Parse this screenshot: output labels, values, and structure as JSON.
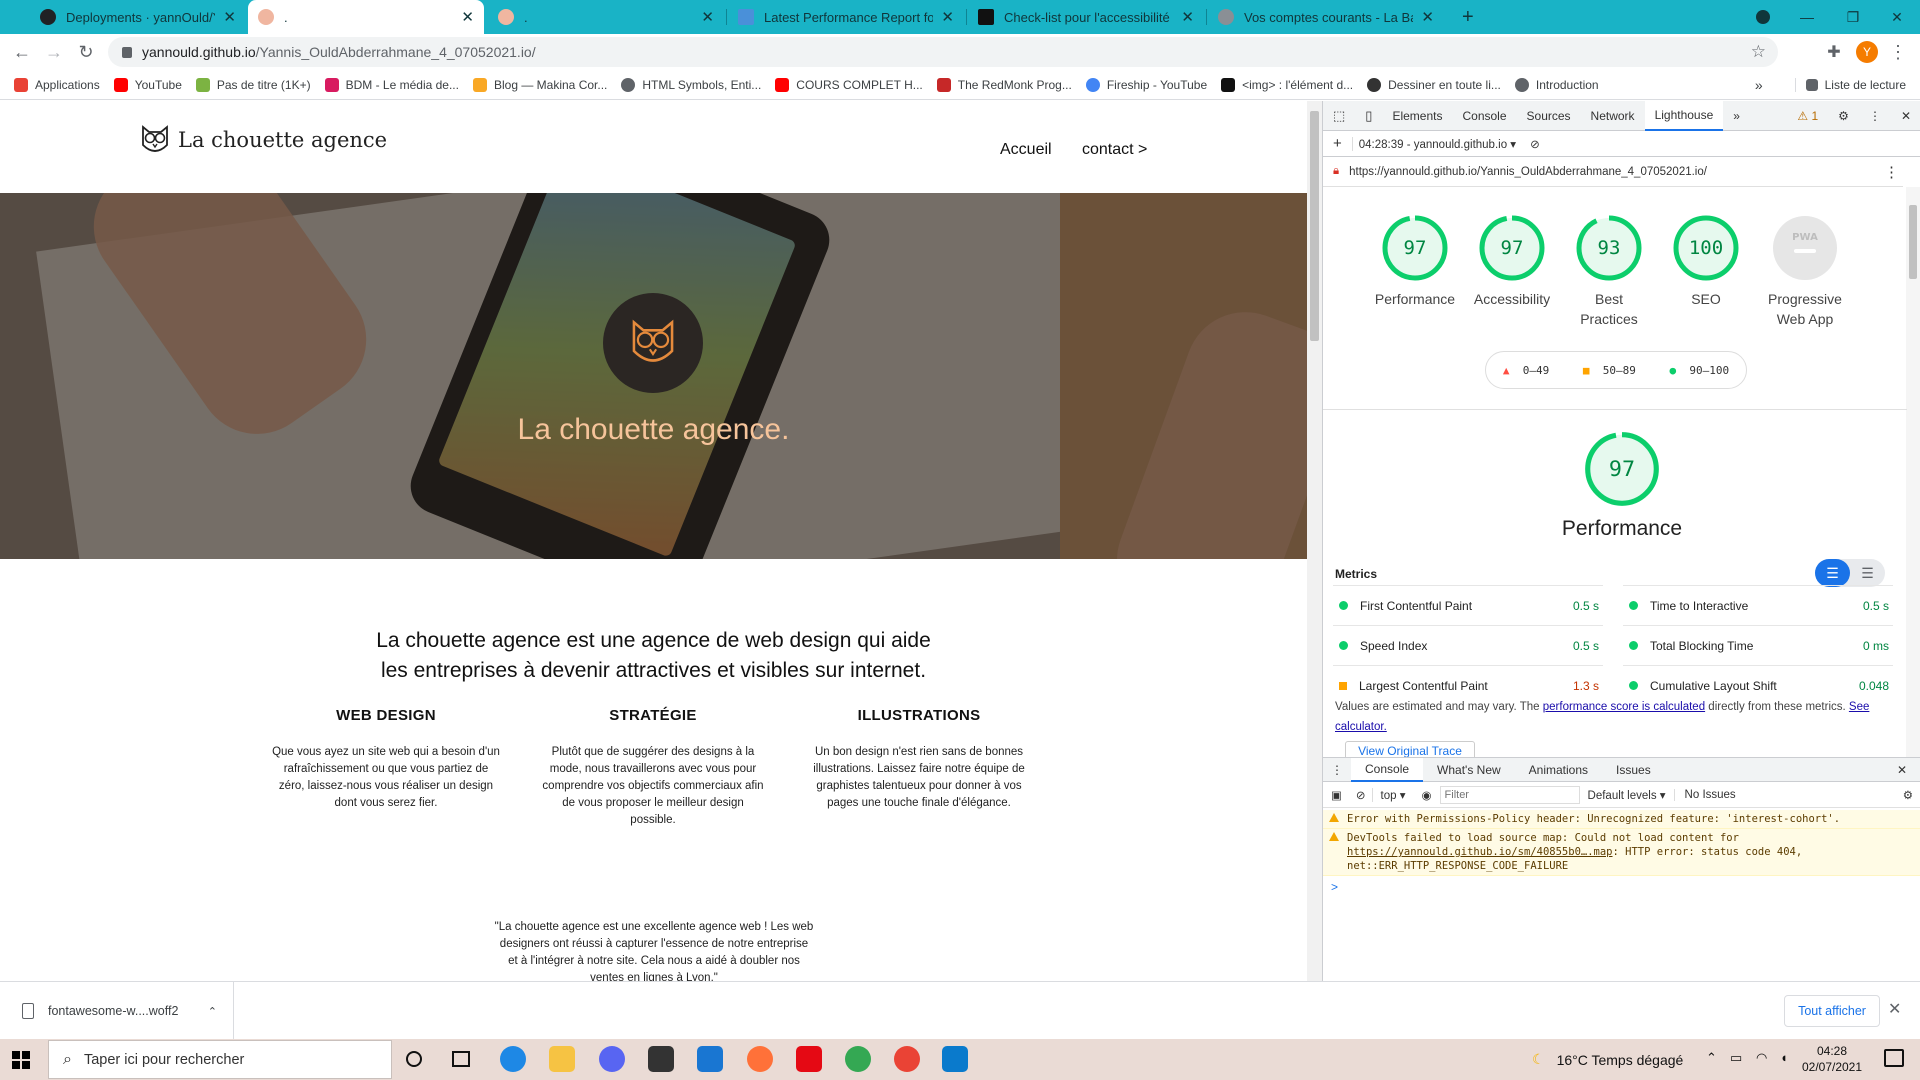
{
  "tabs": [
    {
      "title": "Deployments · yannOuld/Yannis_",
      "fav": "#202124",
      "favtxt": ""
    },
    {
      "title": ".",
      "fav": "#f0b6a0",
      "favtxt": ""
    },
    {
      "title": ".",
      "fav": "#f0b6a0",
      "favtxt": ""
    },
    {
      "title": "Latest Performance Report for: ht",
      "fav": "#4a90d9",
      "favtxt": ""
    },
    {
      "title": "Check-list pour l'accessibilité mo",
      "fav": "#111111",
      "favtxt": ""
    },
    {
      "title": "Vos comptes courants - La Banqu",
      "fav": "#8a8f95",
      "favtxt": ""
    }
  ],
  "new_tab": "+",
  "url": {
    "host": "yannould.github.io",
    "path": "/Yannis_OuldAbderrahmane_4_07052021.io/"
  },
  "bookmarks": [
    {
      "label": "Applications",
      "color": "#e94235"
    },
    {
      "label": "YouTube",
      "color": "#ff0000"
    },
    {
      "label": "Pas de titre (1K+)",
      "color": "#7cb342"
    },
    {
      "label": "BDM - Le média de...",
      "color": "#d81b60"
    },
    {
      "label": "Blog — Makina Cor...",
      "color": "#f9a825"
    },
    {
      "label": "HTML Symbols, Enti...",
      "color": "#5f6368"
    },
    {
      "label": "COURS COMPLET H...",
      "color": "#ff0000"
    },
    {
      "label": "The RedMonk Prog...",
      "color": "#c62828"
    },
    {
      "label": "Fireship - YouTube",
      "color": "#4285f4"
    },
    {
      "label": "<img> : l'élément d...",
      "color": "#111111"
    },
    {
      "label": "Dessiner en toute li...",
      "color": "#333333"
    },
    {
      "label": "Introduction",
      "color": "#5f6368"
    }
  ],
  "bookmarks_more": "»",
  "reading_list": "Liste de lecture",
  "site": {
    "logo_text": "La chouette agence",
    "nav": [
      "Accueil",
      "contact >"
    ],
    "hero_title": "La chouette agence.",
    "intro_line1": "La chouette agence est une agence de web design qui aide",
    "intro_line2": "les entreprises à devenir attractives et visibles sur internet.",
    "columns": [
      {
        "title": "WEB DESIGN",
        "text": "Que vous ayez un site web qui a besoin d'un rafraîchissement ou que vous partiez de zéro, laissez-nous vous réaliser un design dont vous serez fier."
      },
      {
        "title": "STRATÉGIE",
        "text": "Plutôt que de suggérer des designs à la mode, nous travaillerons avec vous pour comprendre vos objectifs commerciaux afin de vous proposer le meilleur design possible."
      },
      {
        "title": "ILLUSTRATIONS",
        "text": "Un bon design n'est rien sans de bonnes illustrations. Laissez faire notre équipe de graphistes talentueux pour donner à vos pages une touche finale d'élégance."
      }
    ],
    "quote": "\"La chouette agence est une excellente agence web ! Les web designers ont réussi à capturer l'essence de notre entreprise et à l'intégrer à notre site. Cela nous a aidé à doubler nos ventes en lignes à Lyon.\""
  },
  "devtools": {
    "tabs": [
      "Elements",
      "Console",
      "Sources",
      "Network",
      "Lighthouse"
    ],
    "active_tab": "Lighthouse",
    "more": "»",
    "warn_count": "1",
    "report_select": "04:28:39 - yannould.github.io",
    "report_url": "https://yannould.github.io/Yannis_OuldAbderrahmane_4_07052021.io/",
    "scores": [
      {
        "value": 97,
        "label_1": "Performance",
        "label_2": ""
      },
      {
        "value": 97,
        "label_1": "Accessibility",
        "label_2": ""
      },
      {
        "value": 93,
        "label_1": "Best",
        "label_2": "Practices"
      },
      {
        "value": 100,
        "label_1": "SEO",
        "label_2": ""
      }
    ],
    "pwa": {
      "badge": "PWA",
      "label_1": "Progressive",
      "label_2": "Web App"
    },
    "legend": [
      "0–49",
      "50–89",
      "90–100"
    ],
    "status_colors": {
      "pass": "#0cce6b",
      "average": "#ffa400",
      "fail": "#ff4e42"
    },
    "big_score": 97,
    "big_title": "Performance",
    "metrics_heading": "Metrics",
    "metrics": [
      {
        "label": "First Contentful Paint",
        "value": "0.5 s",
        "status": "pass"
      },
      {
        "label": "Time to Interactive",
        "value": "0.5 s",
        "status": "pass"
      },
      {
        "label": "Speed Index",
        "value": "0.5 s",
        "status": "pass"
      },
      {
        "label": "Total Blocking Time",
        "value": "0 ms",
        "status": "pass"
      },
      {
        "label": "Largest Contentful Paint",
        "value": "1.3 s",
        "status": "average"
      },
      {
        "label": "Cumulative Layout Shift",
        "value": "0.048",
        "status": "pass"
      }
    ],
    "note_1": "Values are estimated and may vary. The ",
    "note_link_1": "performance score is calculated",
    "note_2": " directly from these metrics. ",
    "note_link_2": "See calculator.",
    "trace_button": "View Original Trace",
    "drawer_tabs": [
      "Console",
      "What's New",
      "Animations",
      "Issues"
    ],
    "console_context": "top",
    "filter_placeholder": "Filter",
    "levels": "Default levels",
    "issues": "No Issues",
    "messages": [
      {
        "text": "Error with Permissions-Policy header: Unrecognized feature: 'interest-cohort'.",
        "link": "",
        "rest": ""
      },
      {
        "text": "DevTools failed to load source map: Could not load content for ",
        "link": "https://yannould.github.io/sm/40855b0….map",
        "rest": ": HTTP error: status code 404, net::ERR_HTTP_RESPONSE_CODE_FAILURE"
      }
    ],
    "prompt": ">"
  },
  "download": {
    "file": "fontawesome-w....woff2",
    "show_all": "Tout afficher"
  },
  "taskbar": {
    "search_placeholder": "Taper ici pour rechercher",
    "weather": "16°C  Temps dégagé",
    "time": "04:28",
    "date": "02/07/2021"
  }
}
